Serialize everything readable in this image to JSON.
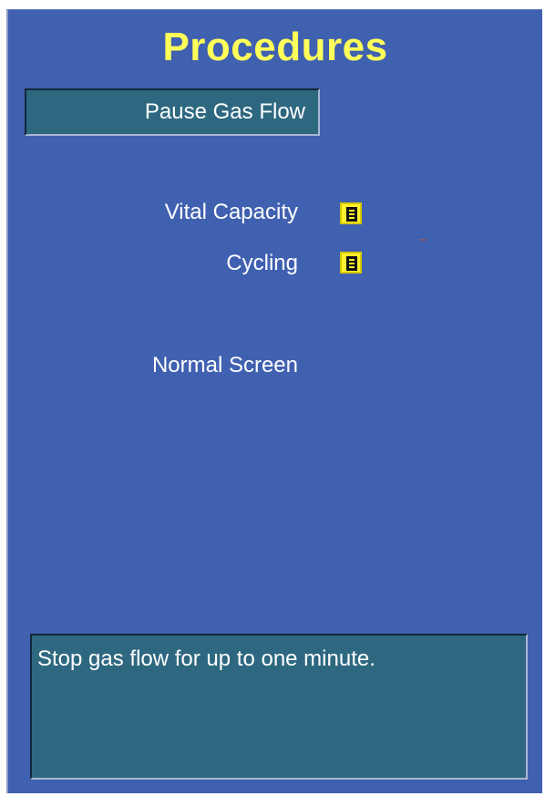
{
  "screen": {
    "title": "Procedures",
    "buttons": {
      "pause_gas_flow": "Pause Gas Flow"
    },
    "items": {
      "vital_capacity": "Vital Capacity",
      "cycling": "Cycling",
      "normal_screen": "Normal Screen"
    },
    "help_text": "Stop gas flow for up to one minute.",
    "icons": {
      "vital_capacity": "document-icon",
      "cycling": "document-icon"
    },
    "colors": {
      "panel": "#4060b0",
      "title": "#ffff5a",
      "button": "#2e6880",
      "icon": "#fff22e"
    }
  }
}
